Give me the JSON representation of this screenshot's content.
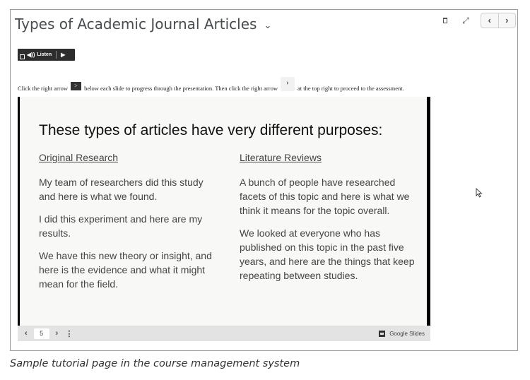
{
  "header": {
    "title": "Types of Academic Journal Articles",
    "title_chevron": "⌄",
    "expand_glyph": "⤢",
    "prev_glyph": "‹",
    "next_glyph": "›"
  },
  "listen": {
    "speaker_glyph": "◀))",
    "label": "Listen",
    "play_glyph": "▶"
  },
  "instructions": {
    "part1": "Click the right arrow",
    "arrow1_glyph": ">",
    "part2": "below each slide to progress through the presentation.  Then click the right arrow",
    "arrow2_glyph": "›",
    "part3": "at the top right to proceed to the assessment."
  },
  "slide": {
    "title": "These types of articles have very different purposes:",
    "left": {
      "heading": "Original Research",
      "p1": "My team of researchers did this study and here is what we found.",
      "p2": "I did this experiment and here are my results.",
      "p3": "We have this new theory or insight, and here is the evidence and what it might mean for the field."
    },
    "right": {
      "heading": "Literature Reviews",
      "p1": "A bunch of people have researched facets of this topic and here is what we think it means for the topic overall.",
      "p2": "We looked at everyone who has published on this topic in the past five years, and here are the things that keep repeating between studies."
    }
  },
  "slide_bar": {
    "prev_glyph": "‹",
    "page": "5",
    "next_glyph": "›",
    "menu_glyph": "⋮",
    "brand": "Google Slides"
  },
  "caption": "Sample tutorial page in the course management system"
}
